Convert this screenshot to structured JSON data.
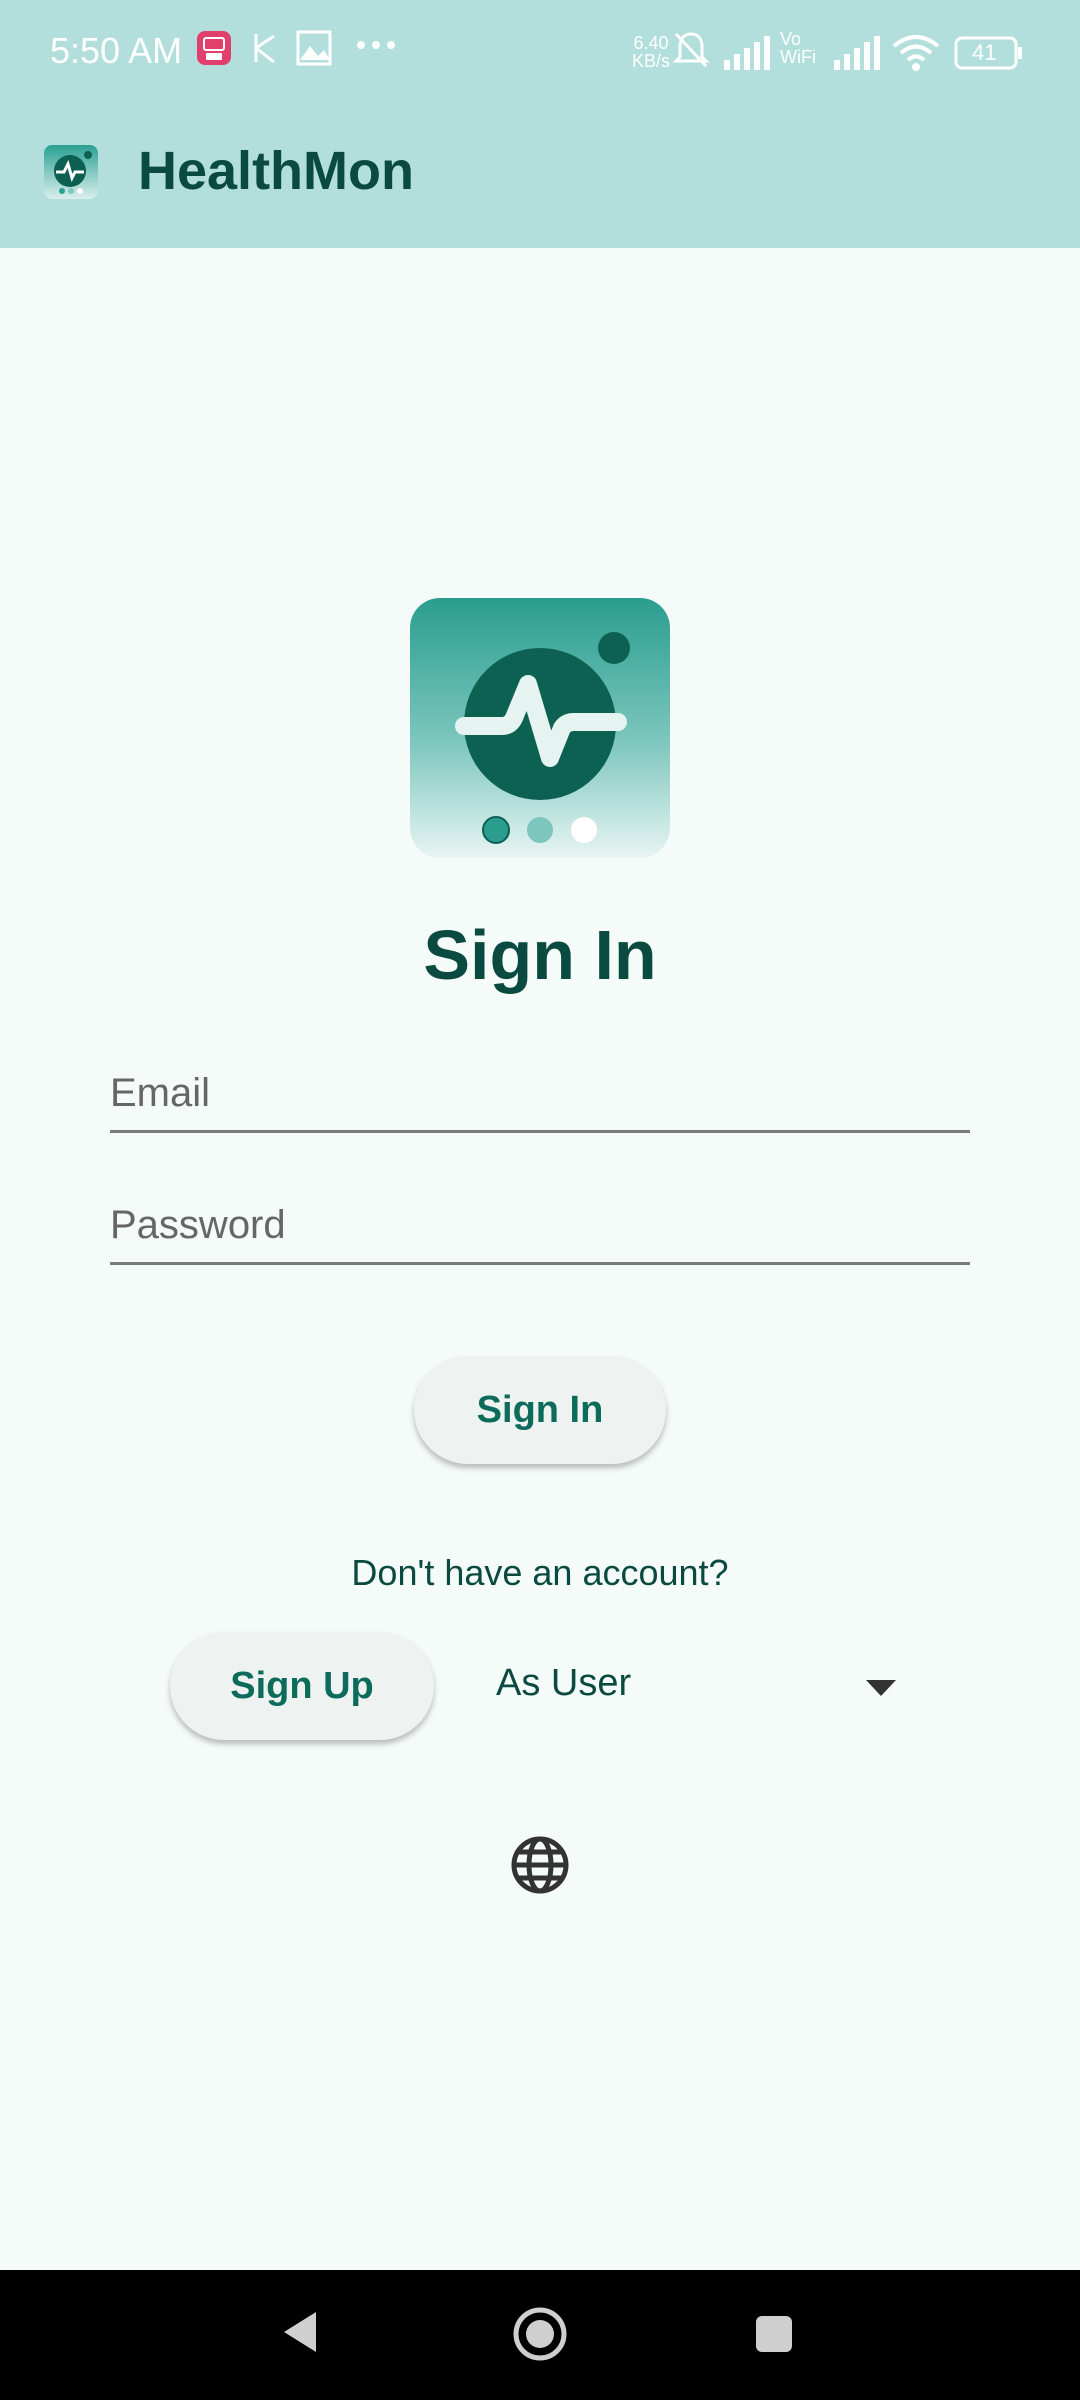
{
  "status_bar": {
    "time": "5:50 AM",
    "net_speed_value": "6.40",
    "net_speed_unit": "KB/s",
    "vowifi_top": "Vo",
    "vowifi_bottom": "WiFi",
    "battery": "41",
    "icons": [
      "notification-badge-icon",
      "link-icon",
      "gallery-icon",
      "more-dots-icon",
      "bell-off-icon",
      "signal-icon",
      "signal-icon",
      "wifi-icon",
      "battery-icon"
    ]
  },
  "app_bar": {
    "title": "HealthMon"
  },
  "main": {
    "title": "Sign In",
    "email_placeholder": "Email",
    "password_placeholder": "Password",
    "sign_in_button": "Sign In",
    "no_account_text": "Don't have an account?",
    "sign_up_button": "Sign Up",
    "role_dropdown_value": "As User"
  },
  "colors": {
    "app_bar": "#b2dfdb",
    "primary_dark": "#0b4a40",
    "accent": "#0d6b5c",
    "background": "#f5fbf9"
  }
}
